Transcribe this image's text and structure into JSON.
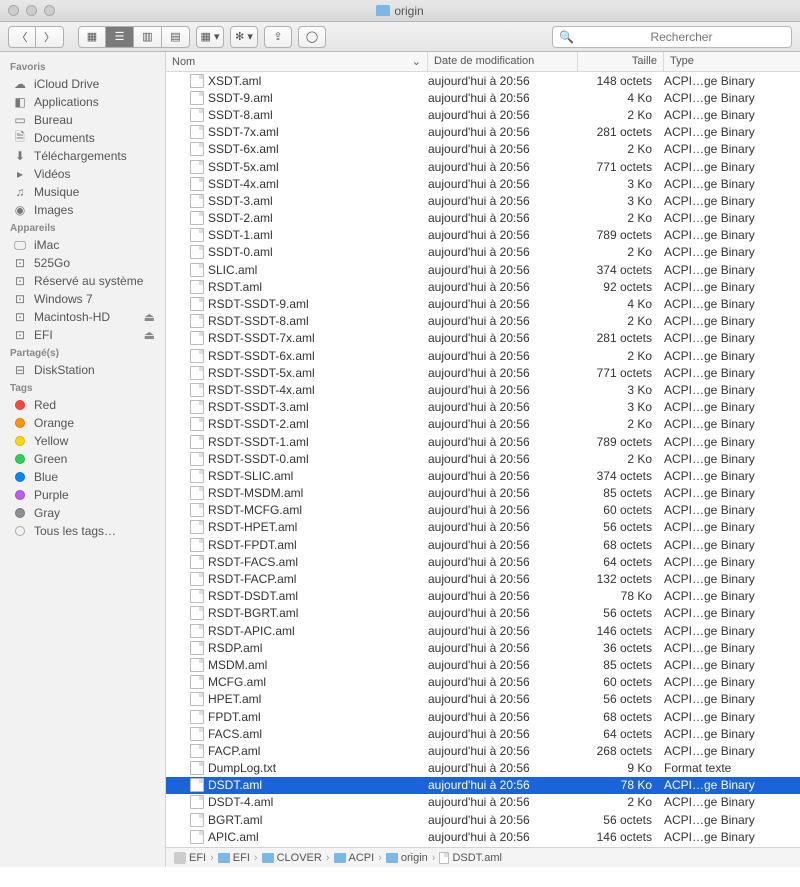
{
  "window": {
    "title": "origin"
  },
  "search": {
    "placeholder": "Rechercher"
  },
  "sidebar": {
    "sections": [
      {
        "heading": "Favoris",
        "items": [
          {
            "icon": "cloud",
            "label": "iCloud Drive"
          },
          {
            "icon": "app",
            "label": "Applications"
          },
          {
            "icon": "desktop",
            "label": "Bureau"
          },
          {
            "icon": "doc",
            "label": "Documents"
          },
          {
            "icon": "download",
            "label": "Téléchargements"
          },
          {
            "icon": "video",
            "label": "Vidéos"
          },
          {
            "icon": "music",
            "label": "Musique"
          },
          {
            "icon": "image",
            "label": "Images"
          }
        ]
      },
      {
        "heading": "Appareils",
        "items": [
          {
            "icon": "imac",
            "label": "iMac"
          },
          {
            "icon": "disk",
            "label": "525Go"
          },
          {
            "icon": "disk",
            "label": "Réservé au système"
          },
          {
            "icon": "disk",
            "label": "Windows 7"
          },
          {
            "icon": "disk",
            "label": "Macintosh-HD",
            "eject": true
          },
          {
            "icon": "disk",
            "label": "EFI",
            "eject": true
          }
        ]
      },
      {
        "heading": "Partagé(s)",
        "items": [
          {
            "icon": "server",
            "label": "DiskStation"
          }
        ]
      },
      {
        "heading": "Tags",
        "items": [
          {
            "color": "#ff4b3e",
            "label": "Red"
          },
          {
            "color": "#ff9500",
            "label": "Orange"
          },
          {
            "color": "#ffd60a",
            "label": "Yellow"
          },
          {
            "color": "#30d158",
            "label": "Green"
          },
          {
            "color": "#0a84ff",
            "label": "Blue"
          },
          {
            "color": "#bf5af2",
            "label": "Purple"
          },
          {
            "color": "#8e8e93",
            "label": "Gray"
          },
          {
            "color": null,
            "label": "Tous les tags…"
          }
        ]
      }
    ]
  },
  "columns": {
    "name": "Nom",
    "date": "Date de modification",
    "size": "Taille",
    "type": "Type"
  },
  "files": [
    {
      "name": "XSDT.aml",
      "date": "aujourd'hui à 20:56",
      "size": "148 octets",
      "type": "ACPI…ge Binary"
    },
    {
      "name": "SSDT-9.aml",
      "date": "aujourd'hui à 20:56",
      "size": "4 Ko",
      "type": "ACPI…ge Binary"
    },
    {
      "name": "SSDT-8.aml",
      "date": "aujourd'hui à 20:56",
      "size": "2 Ko",
      "type": "ACPI…ge Binary"
    },
    {
      "name": "SSDT-7x.aml",
      "date": "aujourd'hui à 20:56",
      "size": "281 octets",
      "type": "ACPI…ge Binary"
    },
    {
      "name": "SSDT-6x.aml",
      "date": "aujourd'hui à 20:56",
      "size": "2 Ko",
      "type": "ACPI…ge Binary"
    },
    {
      "name": "SSDT-5x.aml",
      "date": "aujourd'hui à 20:56",
      "size": "771 octets",
      "type": "ACPI…ge Binary"
    },
    {
      "name": "SSDT-4x.aml",
      "date": "aujourd'hui à 20:56",
      "size": "3 Ko",
      "type": "ACPI…ge Binary"
    },
    {
      "name": "SSDT-3.aml",
      "date": "aujourd'hui à 20:56",
      "size": "3 Ko",
      "type": "ACPI…ge Binary"
    },
    {
      "name": "SSDT-2.aml",
      "date": "aujourd'hui à 20:56",
      "size": "2 Ko",
      "type": "ACPI…ge Binary"
    },
    {
      "name": "SSDT-1.aml",
      "date": "aujourd'hui à 20:56",
      "size": "789 octets",
      "type": "ACPI…ge Binary"
    },
    {
      "name": "SSDT-0.aml",
      "date": "aujourd'hui à 20:56",
      "size": "2 Ko",
      "type": "ACPI…ge Binary"
    },
    {
      "name": "SLIC.aml",
      "date": "aujourd'hui à 20:56",
      "size": "374 octets",
      "type": "ACPI…ge Binary"
    },
    {
      "name": "RSDT.aml",
      "date": "aujourd'hui à 20:56",
      "size": "92 octets",
      "type": "ACPI…ge Binary"
    },
    {
      "name": "RSDT-SSDT-9.aml",
      "date": "aujourd'hui à 20:56",
      "size": "4 Ko",
      "type": "ACPI…ge Binary"
    },
    {
      "name": "RSDT-SSDT-8.aml",
      "date": "aujourd'hui à 20:56",
      "size": "2 Ko",
      "type": "ACPI…ge Binary"
    },
    {
      "name": "RSDT-SSDT-7x.aml",
      "date": "aujourd'hui à 20:56",
      "size": "281 octets",
      "type": "ACPI…ge Binary"
    },
    {
      "name": "RSDT-SSDT-6x.aml",
      "date": "aujourd'hui à 20:56",
      "size": "2 Ko",
      "type": "ACPI…ge Binary"
    },
    {
      "name": "RSDT-SSDT-5x.aml",
      "date": "aujourd'hui à 20:56",
      "size": "771 octets",
      "type": "ACPI…ge Binary"
    },
    {
      "name": "RSDT-SSDT-4x.aml",
      "date": "aujourd'hui à 20:56",
      "size": "3 Ko",
      "type": "ACPI…ge Binary"
    },
    {
      "name": "RSDT-SSDT-3.aml",
      "date": "aujourd'hui à 20:56",
      "size": "3 Ko",
      "type": "ACPI…ge Binary"
    },
    {
      "name": "RSDT-SSDT-2.aml",
      "date": "aujourd'hui à 20:56",
      "size": "2 Ko",
      "type": "ACPI…ge Binary"
    },
    {
      "name": "RSDT-SSDT-1.aml",
      "date": "aujourd'hui à 20:56",
      "size": "789 octets",
      "type": "ACPI…ge Binary"
    },
    {
      "name": "RSDT-SSDT-0.aml",
      "date": "aujourd'hui à 20:56",
      "size": "2 Ko",
      "type": "ACPI…ge Binary"
    },
    {
      "name": "RSDT-SLIC.aml",
      "date": "aujourd'hui à 20:56",
      "size": "374 octets",
      "type": "ACPI…ge Binary"
    },
    {
      "name": "RSDT-MSDM.aml",
      "date": "aujourd'hui à 20:56",
      "size": "85 octets",
      "type": "ACPI…ge Binary"
    },
    {
      "name": "RSDT-MCFG.aml",
      "date": "aujourd'hui à 20:56",
      "size": "60 octets",
      "type": "ACPI…ge Binary"
    },
    {
      "name": "RSDT-HPET.aml",
      "date": "aujourd'hui à 20:56",
      "size": "56 octets",
      "type": "ACPI…ge Binary"
    },
    {
      "name": "RSDT-FPDT.aml",
      "date": "aujourd'hui à 20:56",
      "size": "68 octets",
      "type": "ACPI…ge Binary"
    },
    {
      "name": "RSDT-FACS.aml",
      "date": "aujourd'hui à 20:56",
      "size": "64 octets",
      "type": "ACPI…ge Binary"
    },
    {
      "name": "RSDT-FACP.aml",
      "date": "aujourd'hui à 20:56",
      "size": "132 octets",
      "type": "ACPI…ge Binary"
    },
    {
      "name": "RSDT-DSDT.aml",
      "date": "aujourd'hui à 20:56",
      "size": "78 Ko",
      "type": "ACPI…ge Binary"
    },
    {
      "name": "RSDT-BGRT.aml",
      "date": "aujourd'hui à 20:56",
      "size": "56 octets",
      "type": "ACPI…ge Binary"
    },
    {
      "name": "RSDT-APIC.aml",
      "date": "aujourd'hui à 20:56",
      "size": "146 octets",
      "type": "ACPI…ge Binary"
    },
    {
      "name": "RSDP.aml",
      "date": "aujourd'hui à 20:56",
      "size": "36 octets",
      "type": "ACPI…ge Binary"
    },
    {
      "name": "MSDM.aml",
      "date": "aujourd'hui à 20:56",
      "size": "85 octets",
      "type": "ACPI…ge Binary"
    },
    {
      "name": "MCFG.aml",
      "date": "aujourd'hui à 20:56",
      "size": "60 octets",
      "type": "ACPI…ge Binary"
    },
    {
      "name": "HPET.aml",
      "date": "aujourd'hui à 20:56",
      "size": "56 octets",
      "type": "ACPI…ge Binary"
    },
    {
      "name": "FPDT.aml",
      "date": "aujourd'hui à 20:56",
      "size": "68 octets",
      "type": "ACPI…ge Binary"
    },
    {
      "name": "FACS.aml",
      "date": "aujourd'hui à 20:56",
      "size": "64 octets",
      "type": "ACPI…ge Binary"
    },
    {
      "name": "FACP.aml",
      "date": "aujourd'hui à 20:56",
      "size": "268 octets",
      "type": "ACPI…ge Binary"
    },
    {
      "name": "DumpLog.txt",
      "date": "aujourd'hui à 20:56",
      "size": "9 Ko",
      "type": "Format texte"
    },
    {
      "name": "DSDT.aml",
      "date": "aujourd'hui à 20:56",
      "size": "78 Ko",
      "type": "ACPI…ge Binary",
      "selected": true
    },
    {
      "name": "DSDT-4.aml",
      "date": "aujourd'hui à 20:56",
      "size": "2 Ko",
      "type": "ACPI…ge Binary"
    },
    {
      "name": "BGRT.aml",
      "date": "aujourd'hui à 20:56",
      "size": "56 octets",
      "type": "ACPI…ge Binary"
    },
    {
      "name": "APIC.aml",
      "date": "aujourd'hui à 20:56",
      "size": "146 octets",
      "type": "ACPI…ge Binary"
    }
  ],
  "path": [
    {
      "icon": "disk",
      "label": "EFI"
    },
    {
      "icon": "folder",
      "label": "EFI"
    },
    {
      "icon": "folder",
      "label": "CLOVER"
    },
    {
      "icon": "folder",
      "label": "ACPI"
    },
    {
      "icon": "folder",
      "label": "origin"
    },
    {
      "icon": "file",
      "label": "DSDT.aml"
    }
  ]
}
